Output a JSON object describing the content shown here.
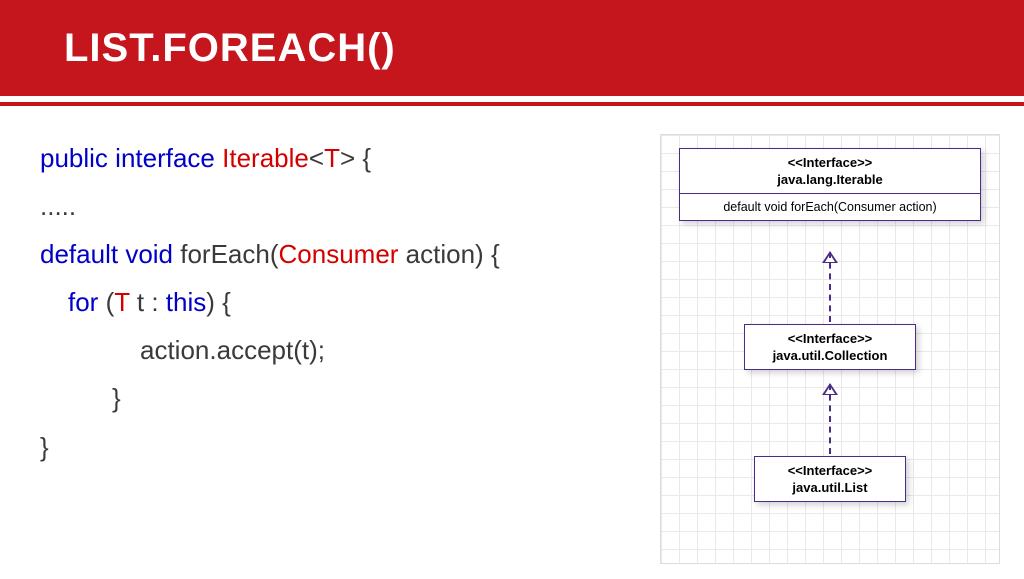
{
  "title": "List.forEach()",
  "code": {
    "l1_kw1": "public",
    "l1_kw2": "interface",
    "l1_name": "Iterable",
    "l1_gen_open": "<",
    "l1_gen_t": "T",
    "l1_gen_close": ">",
    "l1_brace": " {",
    "l2_dots": ".....",
    "l3_kw1": "default",
    "l3_kw2": "void",
    "l3_fn": " forEach(",
    "l3_param_type": "Consumer",
    "l3_param_rest": " action) {",
    "l4_for": "for",
    "l4_open": " (",
    "l4_t1": "T",
    "l4_mid": " t : ",
    "l4_this": "this",
    "l4_close": ") {",
    "l5": "action.accept(t);",
    "l6": "}",
    "l7": "}"
  },
  "diagram": {
    "iterable": {
      "stereo": "<<Interface>>",
      "name": "java.lang.Iterable",
      "method": "default void forEach(Consumer action)"
    },
    "collection": {
      "stereo": "<<Interface>>",
      "name": "java.util.Collection"
    },
    "list": {
      "stereo": "<<Interface>>",
      "name": "java.util.List"
    }
  }
}
